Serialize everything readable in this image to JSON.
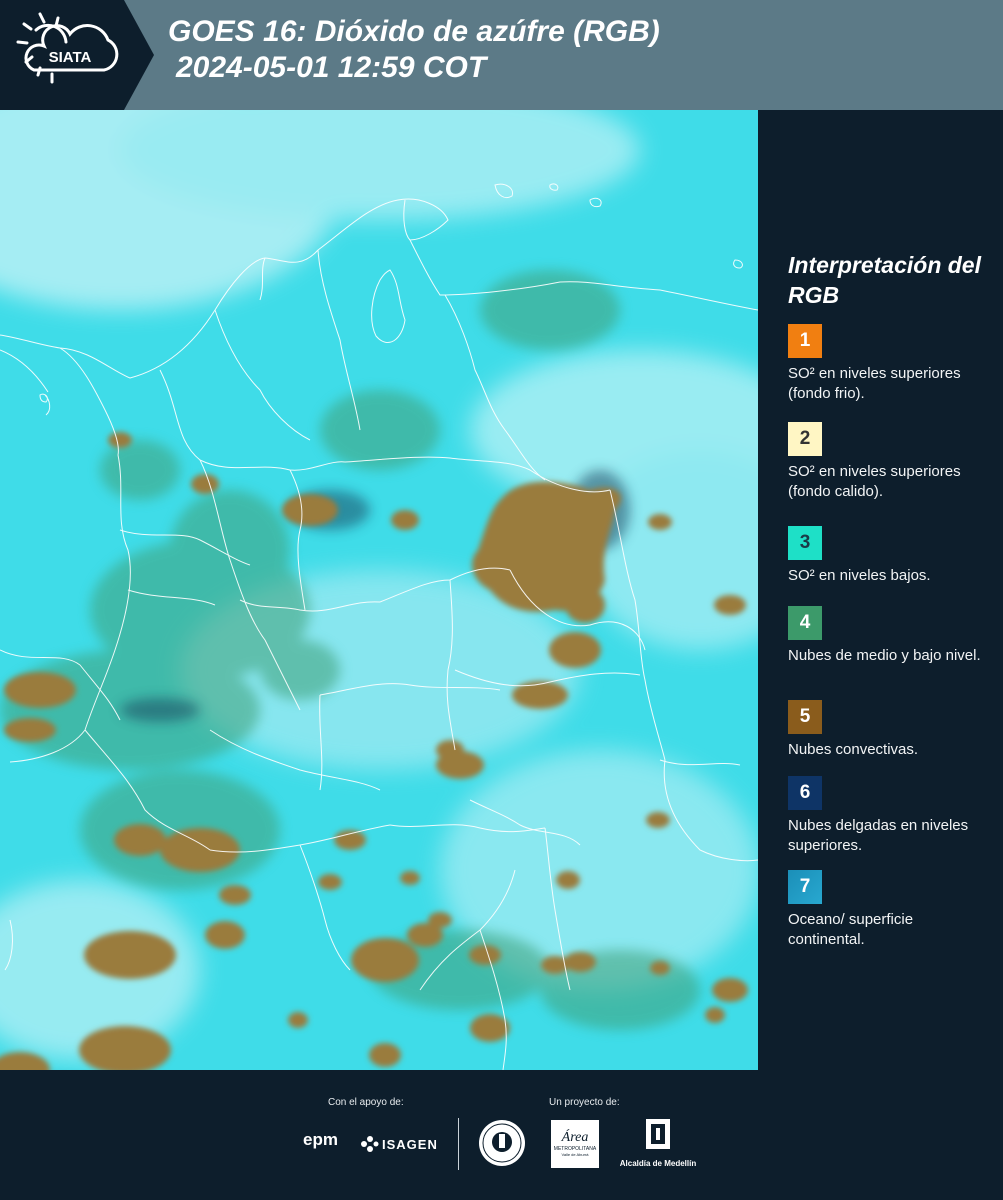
{
  "header": {
    "title_line1": "GOES 16: Dióxido de azúfre (RGB)",
    "title_line2": "2024-05-01 12:59 COT",
    "logo_text": "SIATA"
  },
  "colors": {
    "header_bg": "#5c7a87",
    "panel_bg": "#0d1e2c",
    "map_base": "#3fdce8",
    "convective_cloud": "#9a7b3e",
    "border_lines": "#ffffff"
  },
  "map": {
    "icons": [
      "cloud-patch",
      "border-line"
    ]
  },
  "legend": {
    "title": "Interpretación del RGB",
    "items": [
      {
        "num": "1",
        "color": "#f17f11",
        "num_color": "#ffffff",
        "text": "SO² en niveles superiores (fondo frio)."
      },
      {
        "num": "2",
        "color": "#fff6c4",
        "num_color": "#333333",
        "text": "SO² en niveles superiores (fondo calido)."
      },
      {
        "num": "3",
        "color": "#1ee0c7",
        "num_color": "#1a3b48",
        "text": "SO² en niveles bajos."
      },
      {
        "num": "4",
        "color": "#3c9a6a",
        "num_color": "#ffffff",
        "text": "Nubes de medio y bajo nivel."
      },
      {
        "num": "5",
        "color": "#8a5c1c",
        "num_color": "#ffffff",
        "text": "Nubes convectivas."
      },
      {
        "num": "6",
        "color": "#0e3466",
        "num_color": "#ffffff",
        "text": "Nubes delgadas en niveles superiores."
      },
      {
        "num": "7",
        "color": "#1b8fb8",
        "num_color": "#ffffff",
        "text": "Oceano/ superficie continental."
      }
    ]
  },
  "footer": {
    "support_label": "Con el apoyo de:",
    "project_label": "Un proyecto de:",
    "sponsors": [
      "epm",
      "ISAGEN"
    ],
    "partners": [
      "Área Metropolitana",
      "Alcaldía de Medellín"
    ],
    "logo_texts": {
      "epm": "epm",
      "isagen": "ISAGEN",
      "area": "Área",
      "area_sub1": "METROPOLITANA",
      "area_sub2": "Valle de Aburrá",
      "alcaldia": "Alcaldía de Medellín"
    }
  }
}
